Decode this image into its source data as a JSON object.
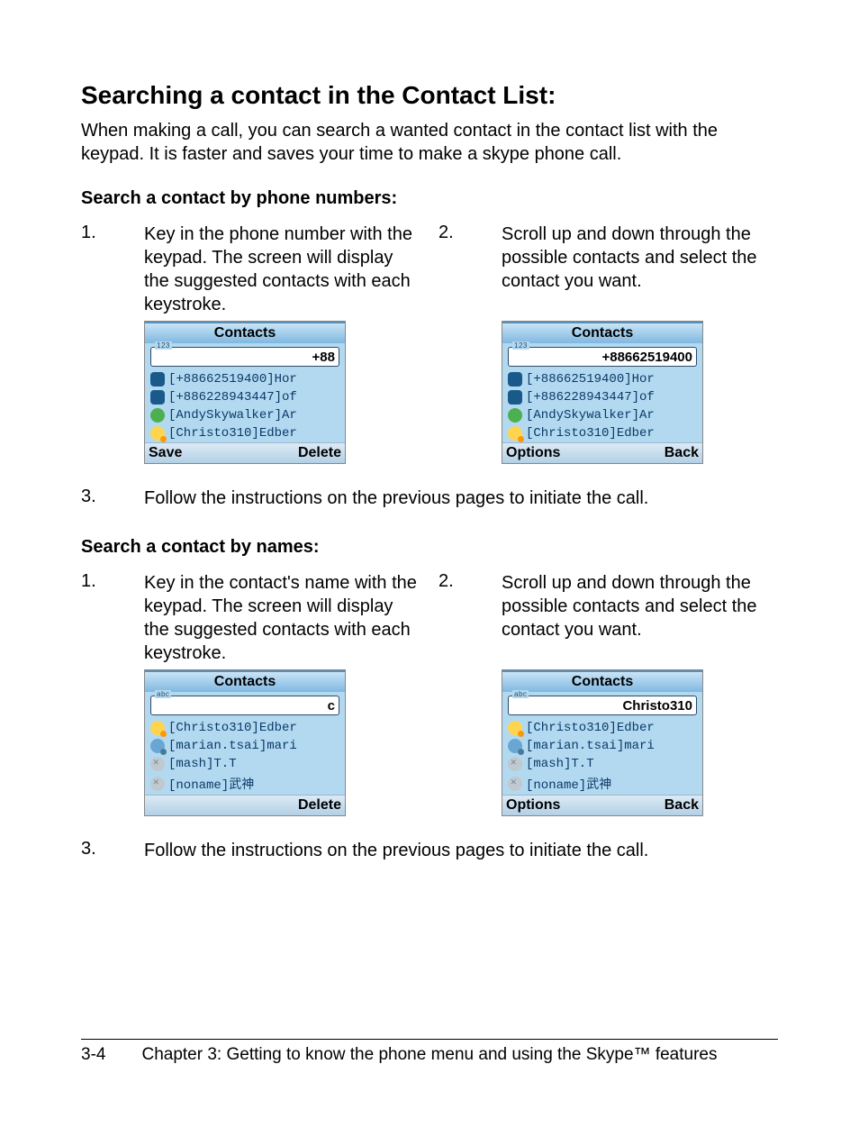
{
  "title": "Searching a contact in the Contact List:",
  "intro": "When making a call, you can search a wanted contact in the contact list with the keypad. It is faster and saves your time to make a skype phone call.",
  "section_numbers": {
    "heading": "Search a contact by phone numbers:",
    "step1_num": "1.",
    "step1_text": "Key in the phone number with the keypad. The screen will display the suggested contacts with each keystroke.",
    "step2_num": "2.",
    "step2_text": "Scroll up and down through the possible contacts and select the contact you want.",
    "step3_num": "3.",
    "step3_text": "Follow the instructions on the previous pages to initiate the call."
  },
  "section_names": {
    "heading": "Search a contact by names:",
    "step1_num": "1.",
    "step1_text": "Key in the contact's name with the keypad. The screen will display the suggested contacts with each keystroke.",
    "step2_num": "2.",
    "step2_text": "Scroll up and down through the possible contacts and select the contact you want.",
    "step3_num": "3.",
    "step3_text": "Follow the instructions on the previous pages to initiate the call."
  },
  "shot_numbers_1": {
    "title": "Contacts",
    "mode": "123",
    "input": "+88",
    "items": [
      {
        "icon": "phone",
        "text": "[+88662519400]Hor"
      },
      {
        "icon": "phone",
        "text": "[+886228943447]of"
      },
      {
        "icon": "green",
        "text": "[AndySkywalker]Ar"
      },
      {
        "icon": "yellow",
        "text": "[Christo310]Edber"
      }
    ],
    "left": "Save",
    "right": "Delete"
  },
  "shot_numbers_2": {
    "title": "Contacts",
    "mode": "123",
    "input": "+88662519400",
    "items": [
      {
        "icon": "phone",
        "text": "[+88662519400]Hor"
      },
      {
        "icon": "phone",
        "text": "[+886228943447]of"
      },
      {
        "icon": "green",
        "text": "[AndySkywalker]Ar"
      },
      {
        "icon": "yellow",
        "text": "[Christo310]Edber"
      }
    ],
    "left": "Options",
    "right": "Back"
  },
  "shot_names_1": {
    "title": "Contacts",
    "mode": "abc",
    "input": "c",
    "items": [
      {
        "icon": "yellow",
        "text": "[Christo310]Edber"
      },
      {
        "icon": "blue",
        "text": "[marian.tsai]mari"
      },
      {
        "icon": "grey",
        "text": "[mash]T.T"
      },
      {
        "icon": "grey",
        "text": "[noname]武神"
      }
    ],
    "left": "",
    "right": "Delete"
  },
  "shot_names_2": {
    "title": "Contacts",
    "mode": "abc",
    "input": "Christo310",
    "items": [
      {
        "icon": "yellow",
        "text": "[Christo310]Edber"
      },
      {
        "icon": "blue",
        "text": "[marian.tsai]mari"
      },
      {
        "icon": "grey",
        "text": "[mash]T.T"
      },
      {
        "icon": "grey",
        "text": "[noname]武神"
      }
    ],
    "left": "Options",
    "right": "Back"
  },
  "footer": {
    "page": "3-4",
    "chapter": "Chapter 3: Getting to know the phone menu and using the Skype™ features"
  }
}
